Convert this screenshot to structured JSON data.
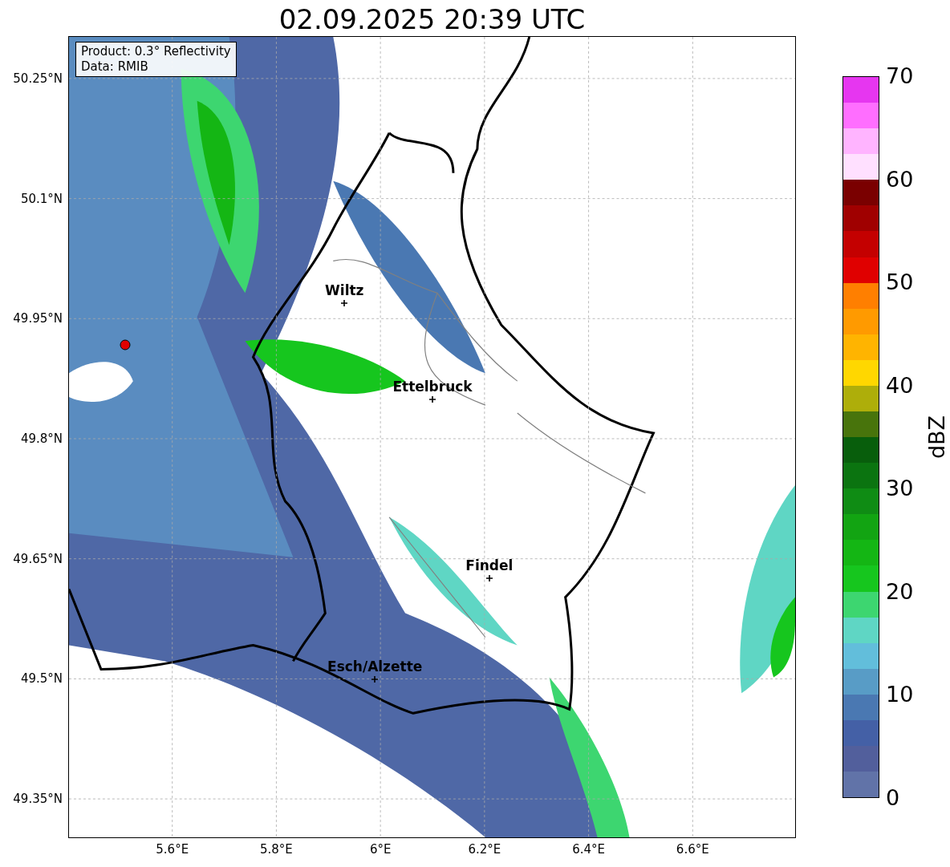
{
  "title": "02.09.2025 20:39 UTC",
  "info_box": [
    "Product: 0.3° Reflectivity",
    "Data: RMIB"
  ],
  "cities": [
    {
      "name": "Wiltz"
    },
    {
      "name": "Ettelbruck"
    },
    {
      "name": "Findel"
    },
    {
      "name": "Esch/Alzette"
    }
  ],
  "y_ticks": [
    "50.25°N",
    "50.1°N",
    "49.95°N",
    "49.8°N",
    "49.65°N",
    "49.5°N",
    "49.35°N"
  ],
  "x_ticks": [
    "5.6°E",
    "5.8°E",
    "6°E",
    "6.2°E",
    "6.4°E",
    "6.6°E"
  ],
  "colorbar": {
    "label": "dBZ",
    "ticks": [
      "70",
      "60",
      "50",
      "40",
      "30",
      "20",
      "10",
      "0"
    ],
    "segments": [
      {
        "color": "#e636f0"
      },
      {
        "color": "#ff6eff"
      },
      {
        "color": "#ffb4ff"
      },
      {
        "color": "#ffe0ff"
      },
      {
        "color": "#7a0000"
      },
      {
        "color": "#a00000"
      },
      {
        "color": "#c40000"
      },
      {
        "color": "#e00000"
      },
      {
        "color": "#ff7f00"
      },
      {
        "color": "#ff9a00"
      },
      {
        "color": "#ffb400"
      },
      {
        "color": "#ffd700"
      },
      {
        "color": "#aeae0a"
      },
      {
        "color": "#48740c"
      },
      {
        "color": "#085e0c"
      },
      {
        "color": "#0b7410"
      },
      {
        "color": "#0f8c14"
      },
      {
        "color": "#12a412"
      },
      {
        "color": "#14b614"
      },
      {
        "color": "#16c61e"
      },
      {
        "color": "#3dd670"
      },
      {
        "color": "#5fd6c4"
      },
      {
        "color": "#62bedb"
      },
      {
        "color": "#589cc6"
      },
      {
        "color": "#4a78b2"
      },
      {
        "color": "#4460a6"
      },
      {
        "color": "#525f9c"
      },
      {
        "color": "#6173a8"
      }
    ]
  }
}
